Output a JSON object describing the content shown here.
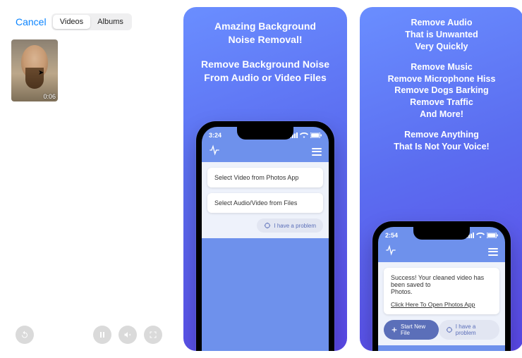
{
  "panel1": {
    "cancel": "Cancel",
    "segments": {
      "videos": "Videos",
      "albums": "Albums"
    },
    "thumb_duration": "0:06"
  },
  "panel2": {
    "headline1_l1": "Amazing Background",
    "headline1_l2": "Noise Removal!",
    "headline2_l1": "Remove Background Noise",
    "headline2_l2": "From Audio or Video Files",
    "time": "3:24",
    "option1": "Select Video from Photos App",
    "option2": "Select Audio/Video from Files",
    "problem": "I have a problem"
  },
  "panel3": {
    "h1_l1": "Remove Audio",
    "h1_l2": "That is Unwanted",
    "h1_l3": "Very Quickly",
    "h2_l1": "Remove Music",
    "h2_l2": "Remove Microphone Hiss",
    "h2_l3": "Remove Dogs Barking",
    "h2_l4": "Remove Traffic",
    "h2_l5": "And More!",
    "h3_l1": "Remove Anything",
    "h3_l2": "That Is Not Your Voice!",
    "time": "2:54",
    "success_l1": "Success! Your cleaned video has been saved to",
    "success_l2": "Photos.",
    "success_link": "Click Here To Open Photos App",
    "start_new": "Start New File",
    "problem": "I have a problem"
  }
}
